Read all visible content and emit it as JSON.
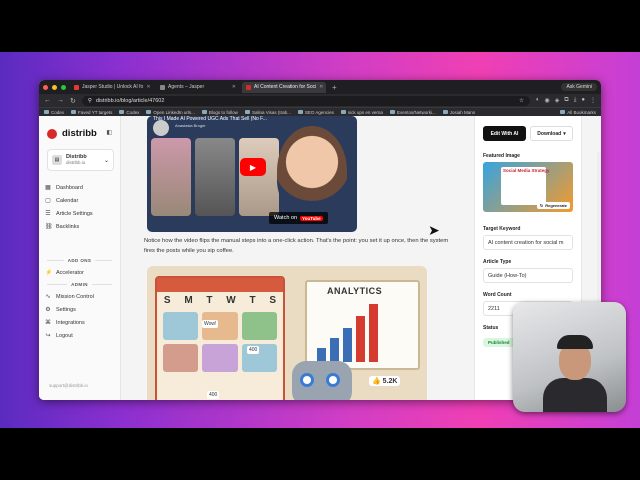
{
  "browser": {
    "tabs": [
      {
        "title": "Jasper Studio | Unlock AI fo",
        "fav": "#e53935",
        "active": false
      },
      {
        "title": "Agents – Jasper",
        "fav": "#888888",
        "active": false
      },
      {
        "title": "AI Content Creation for Soci",
        "fav": "#d92a2a",
        "active": true
      }
    ],
    "new_tab": "+",
    "gemini": "Ask Gemini",
    "url": "distribb.io/blog/article/47602",
    "bookmarks": [
      "Codex",
      "Faved YT targets",
      "Codex",
      "Open LinkedIn urls...",
      "Blogs to follow",
      "Salina Visas (trab...",
      "SEO Agencies",
      "sick ups en verna",
      "Eventos/Networki...",
      "Josiah Mann",
      "All Bookmarks"
    ]
  },
  "sidebar": {
    "brand": "distribb",
    "workspace": {
      "name": "Distribb",
      "domain": "distribb.io"
    },
    "nav": [
      {
        "label": "Dashboard",
        "icon": "▦"
      },
      {
        "label": "Calendar",
        "icon": "▢"
      },
      {
        "label": "Article Settings",
        "icon": "☰"
      },
      {
        "label": "Backlinks",
        "icon": "⛓"
      }
    ],
    "addons_label": "ADD ONS",
    "addons": [
      {
        "label": "Accelerator",
        "icon": "⚡"
      }
    ],
    "admin_label": "ADMIN",
    "admin": [
      {
        "label": "Mission Control",
        "icon": "∿"
      },
      {
        "label": "Settings",
        "icon": "⚙"
      },
      {
        "label": "Integrations",
        "icon": "⌘"
      },
      {
        "label": "Logout",
        "icon": "↪"
      }
    ],
    "support": "support@distribb.io"
  },
  "article": {
    "video_title": "This I Made AI Powered UGC Ads That Sell (No F...",
    "video_channel": "Anastasia Broger",
    "watch_on": "Watch on",
    "youtube": "YouTube",
    "paragraph": "Notice how the video flips the manual steps into a one-click action. That's the point: you set it up once, then the system fires the posts while you sip coffee.",
    "illus_days": [
      "S",
      "M",
      "T",
      "W",
      "T",
      "S"
    ],
    "illus_wow": "Wow!",
    "illus_400": "400",
    "illus_analytics": "ANALYTICS",
    "illus_likes": "5.2K"
  },
  "panel": {
    "edit_btn": "Edit With AI",
    "download_btn": "Download",
    "featured_label": "Featured Image",
    "featured_title": "Social Media Strategy",
    "regenerate": "Regenerate",
    "keyword_label": "Target Keyword",
    "keyword_value": "AI content creation for social m",
    "type_label": "Article Type",
    "type_value": "Guide (How-To)",
    "wordcount_label": "Word Count",
    "wordcount_value": "2211",
    "status_label": "Status",
    "status_value": "Published"
  }
}
